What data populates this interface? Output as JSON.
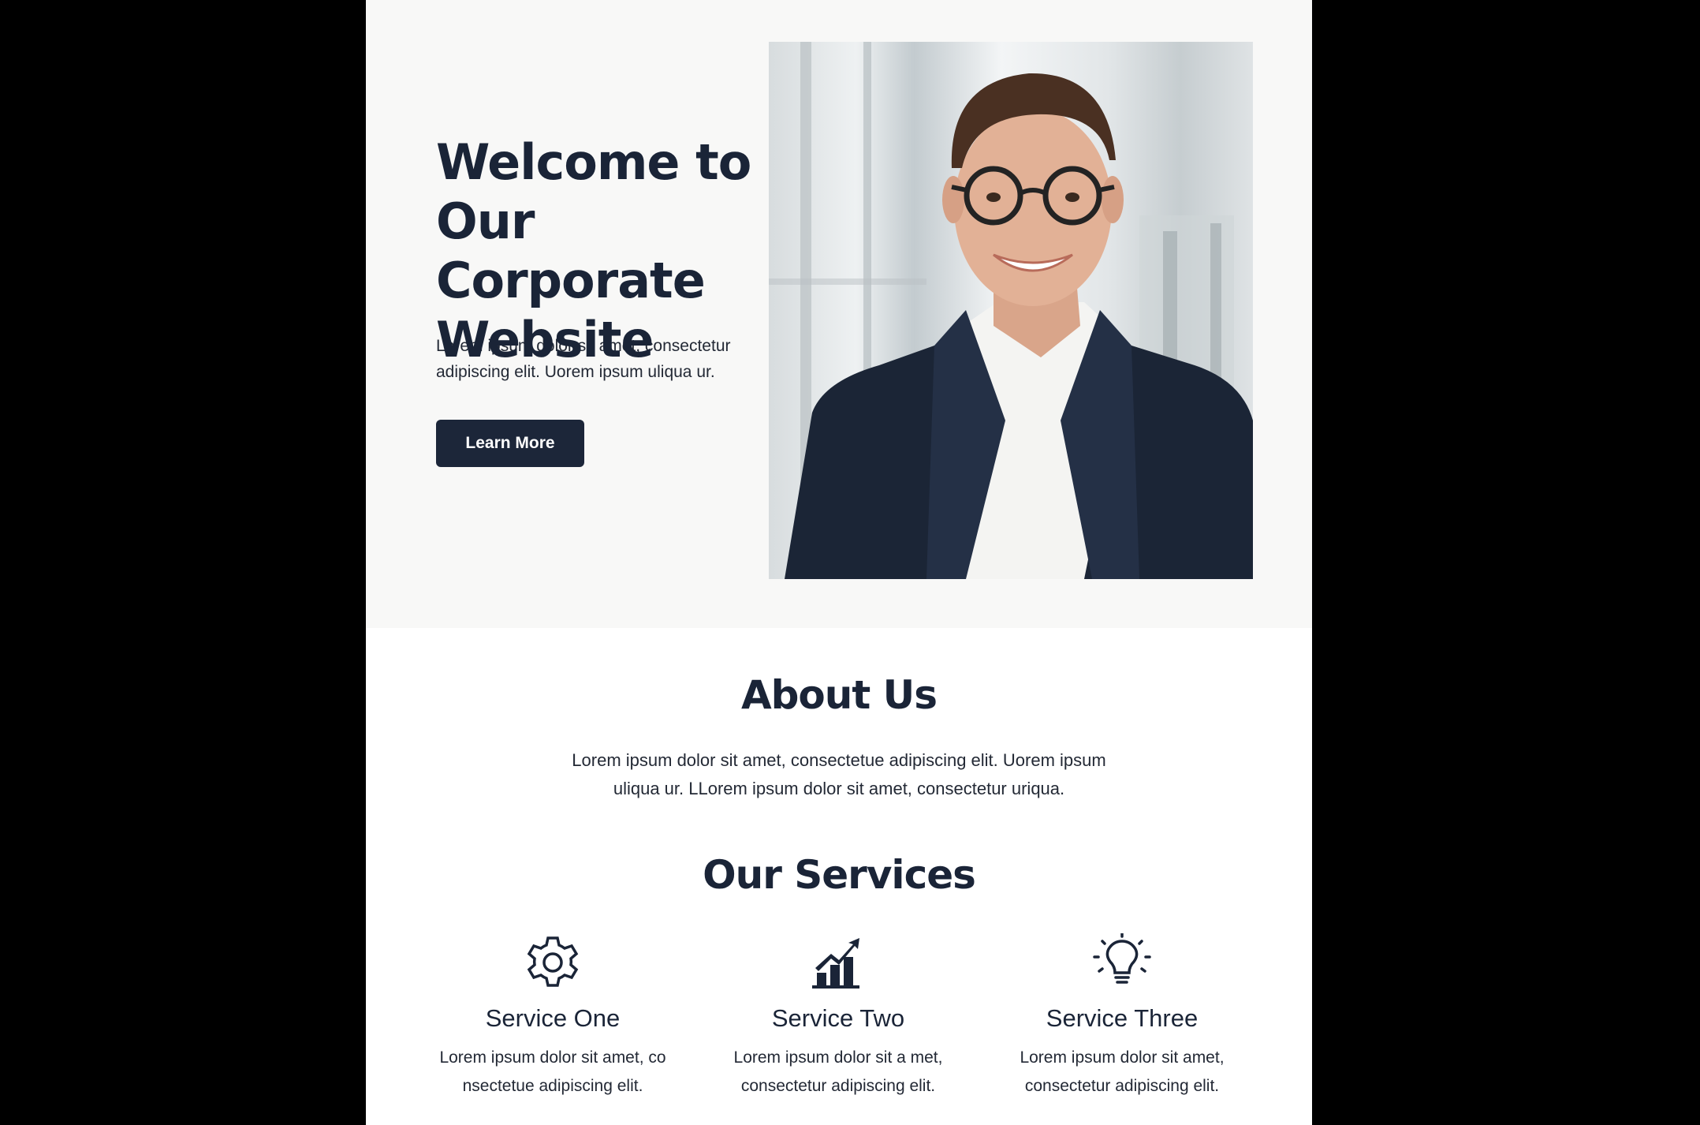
{
  "hero": {
    "title": "Welcome to Our Corporate Website",
    "text": "Lorem ipsum dolor sit amet, consectetur adipiscing elit. Uorem ipsum uliqua ur.",
    "button_label": "Learn More"
  },
  "about": {
    "title": "About Us",
    "text": "Lorem ipsum dolor sit amet, consectetue adipiscing elit. Uorem ipsum uliqua ur. LLorem ipsum dolor sit amet, consectetur uriqua."
  },
  "services": {
    "title": "Our Services",
    "items": [
      {
        "icon": "gear-icon",
        "name": "Service One",
        "text": "Lorem ipsum dolor sit amet, co nsectetue adipiscing elit."
      },
      {
        "icon": "growth-chart-icon",
        "name": "Service Two",
        "text": "Lorem ipsum dolor sit a met, consectetur adipiscing elit."
      },
      {
        "icon": "lightbulb-icon",
        "name": "Service Three",
        "text": "Lorem ipsum dolor sit amet, consectetur adipiscing elit."
      }
    ]
  },
  "colors": {
    "primary": "#1c2639",
    "hero_background": "#f8f8f7",
    "outer_background": "#000000"
  }
}
